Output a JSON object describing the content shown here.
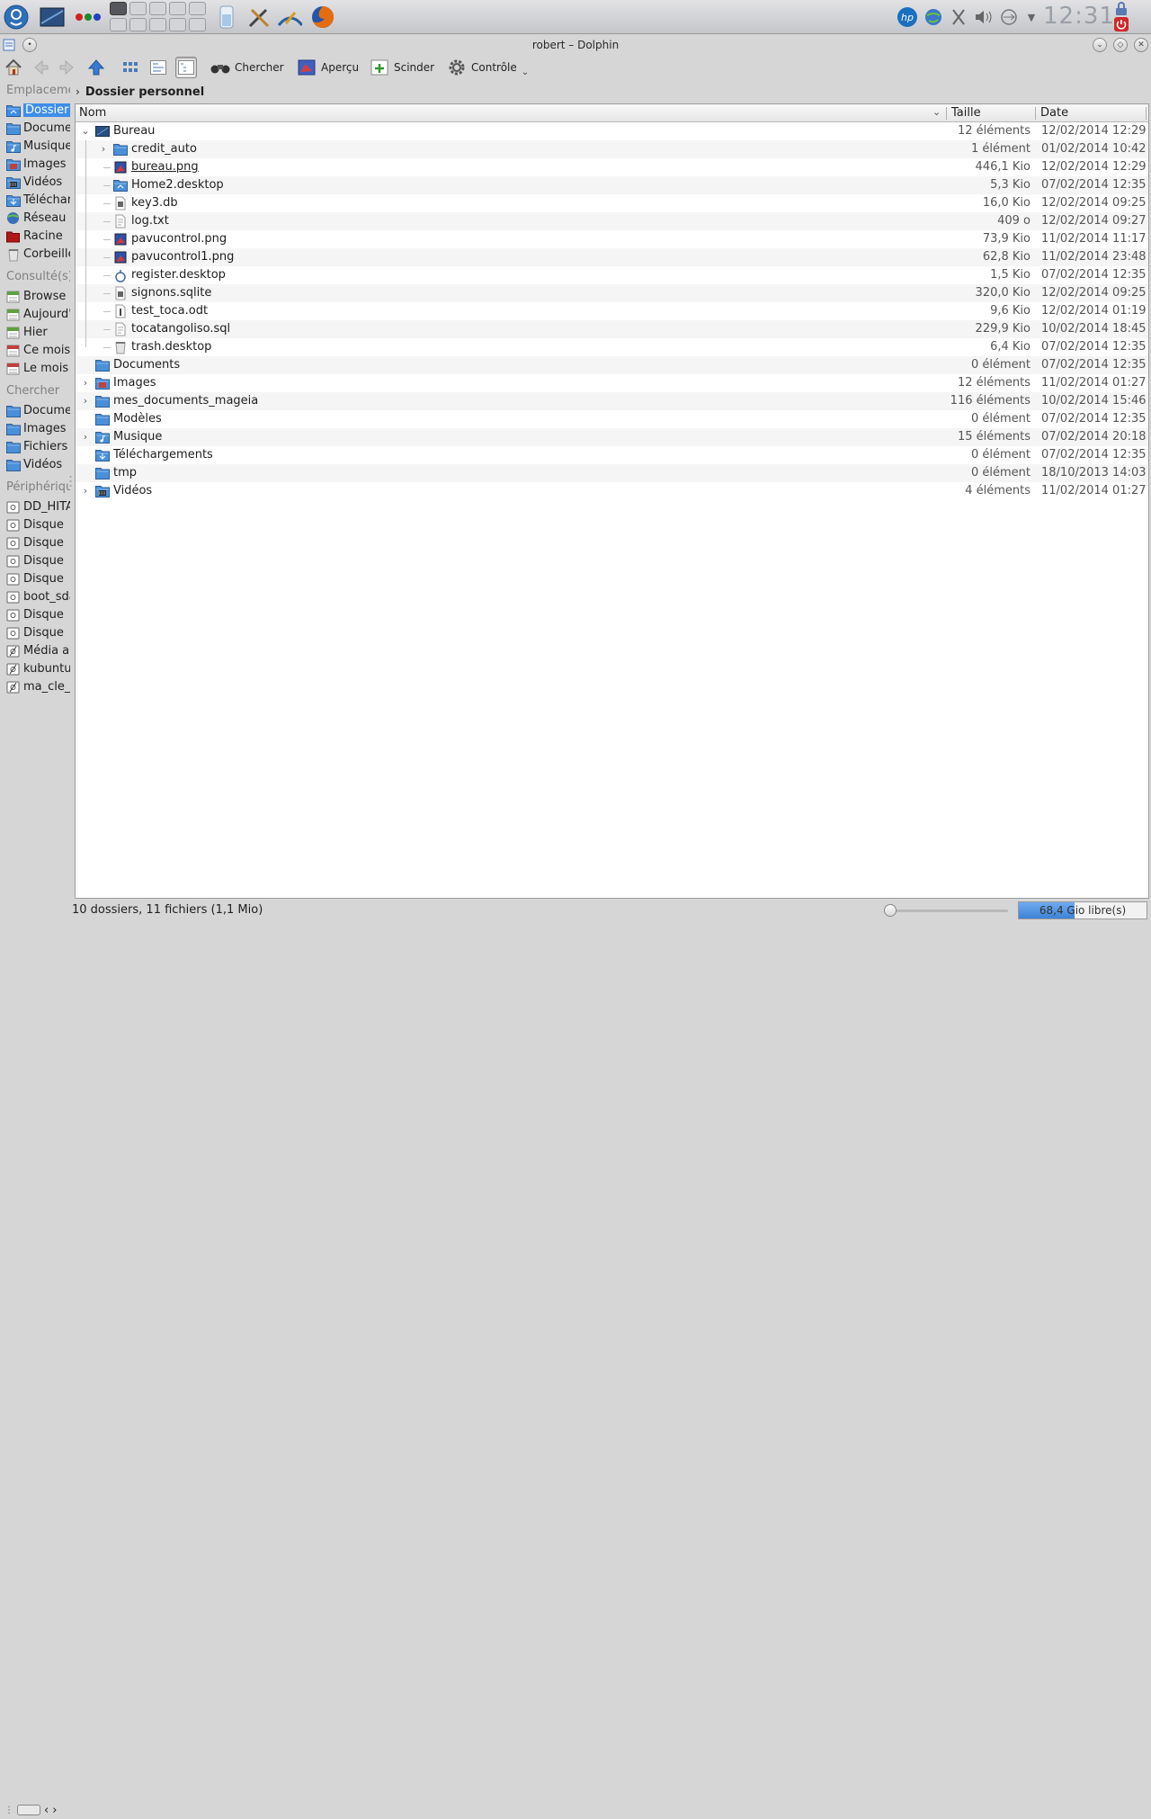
{
  "panel": {
    "clock": "12:31",
    "icons": [
      "mageia-menu-icon",
      "desktop-icon",
      "colors-icon",
      "battery-widget-icon",
      "tools-icon",
      "draw-icon",
      "firefox-icon"
    ],
    "tray": [
      "hp-icon",
      "network-globe-icon",
      "scissors-icon",
      "volume-icon",
      "usb-icon",
      "chevron-down-icon",
      "lock-icon",
      "power-icon"
    ]
  },
  "window": {
    "title": "robert – Dolphin"
  },
  "toolbar": {
    "search": "Chercher",
    "preview": "Aperçu",
    "split": "Scinder",
    "control": "Contrôle"
  },
  "places": {
    "sections": [
      {
        "title": "Emplacements",
        "items": [
          {
            "label": "Dossier personnel",
            "icon": "home-folder-icon",
            "color": "#3d8ee6"
          },
          {
            "label": "Documents",
            "icon": "folder-icon",
            "color": "#4a90d9"
          },
          {
            "label": "Musique",
            "icon": "music-folder-icon",
            "color": "#4a90d9"
          },
          {
            "label": "Images",
            "icon": "images-folder-icon",
            "color": "#4a90d9"
          },
          {
            "label": "Vidéos",
            "icon": "videos-folder-icon",
            "color": "#4a90d9"
          },
          {
            "label": "Téléchargements",
            "icon": "download-folder-icon",
            "color": "#4a90d9"
          },
          {
            "label": "Réseau",
            "icon": "network-icon",
            "color": "#3a6fb8"
          },
          {
            "label": "Racine",
            "icon": "root-folder-icon",
            "color": "#b01818"
          },
          {
            "label": "Corbeille",
            "icon": "trash-icon",
            "color": "#bdbdbd"
          }
        ]
      },
      {
        "title": "Consulté(s) récemment",
        "items": [
          {
            "label": "Browse",
            "icon": "calendar-icon",
            "color": "#60a040"
          },
          {
            "label": "Aujourd'hui",
            "icon": "calendar-icon",
            "color": "#60a040"
          },
          {
            "label": "Hier",
            "icon": "calendar-icon",
            "color": "#60a040"
          },
          {
            "label": "Ce mois",
            "icon": "calendar-icon",
            "color": "#c04040"
          },
          {
            "label": "Le mois dernier",
            "icon": "calendar-icon",
            "color": "#c04040"
          }
        ]
      },
      {
        "title": "Chercher",
        "items": [
          {
            "label": "Documents",
            "icon": "search-documents-icon",
            "color": "#4a90d9"
          },
          {
            "label": "Images",
            "icon": "search-images-icon",
            "color": "#4a90d9"
          },
          {
            "label": "Fichiers audio",
            "icon": "search-audio-icon",
            "color": "#4a90d9"
          },
          {
            "label": "Vidéos",
            "icon": "search-videos-icon",
            "color": "#4a90d9"
          }
        ]
      },
      {
        "title": "Périphériques",
        "items": [
          {
            "label": "DD_HITACHI",
            "icon": "drive-icon",
            "color": "#888"
          },
          {
            "label": "Disque",
            "icon": "drive-icon",
            "color": "#888"
          },
          {
            "label": "Disque",
            "icon": "drive-icon",
            "color": "#888"
          },
          {
            "label": "Disque",
            "icon": "drive-icon",
            "color": "#888"
          },
          {
            "label": "Disque",
            "icon": "drive-icon",
            "color": "#888"
          },
          {
            "label": "boot_sda",
            "icon": "drive-icon",
            "color": "#888"
          },
          {
            "label": "Disque",
            "icon": "drive-icon",
            "color": "#888"
          },
          {
            "label": "Disque",
            "icon": "drive-icon",
            "color": "#888"
          },
          {
            "label": "Média amovible",
            "icon": "removable-drive-icon",
            "color": "#888"
          },
          {
            "label": "kubuntu",
            "icon": "removable-drive-icon",
            "color": "#888"
          },
          {
            "label": "ma_cle_usb",
            "icon": "removable-drive-icon",
            "color": "#888"
          }
        ]
      }
    ]
  },
  "breadcrumb": {
    "current": "Dossier personnel"
  },
  "columns": {
    "name": "Nom",
    "size": "Taille",
    "date": "Date"
  },
  "files": [
    {
      "name": "Bureau",
      "size": "12 éléments",
      "date": "12/02/2014 12:29",
      "level": 0,
      "exp": "open",
      "icon": "desktop-folder-icon"
    },
    {
      "name": "credit_auto",
      "size": "1 élément",
      "date": "01/02/2014 10:42",
      "level": 1,
      "exp": "closed",
      "icon": "folder-icon"
    },
    {
      "name": "bureau.png",
      "size": "446,1 Kio",
      "date": "12/02/2014 12:29",
      "level": 1,
      "exp": "",
      "icon": "image-file-icon",
      "hover": true
    },
    {
      "name": "Home2.desktop",
      "size": "5,3 Kio",
      "date": "07/02/2014 12:35",
      "level": 1,
      "exp": "",
      "icon": "home-folder-icon"
    },
    {
      "name": "key3.db",
      "size": "16,0 Kio",
      "date": "12/02/2014 09:25",
      "level": 1,
      "exp": "",
      "icon": "db-file-icon"
    },
    {
      "name": "log.txt",
      "size": "409 o",
      "date": "12/02/2014 09:27",
      "level": 1,
      "exp": "",
      "icon": "text-file-icon"
    },
    {
      "name": "pavucontrol.png",
      "size": "73,9 Kio",
      "date": "11/02/2014 11:17",
      "level": 1,
      "exp": "",
      "icon": "image-file-icon"
    },
    {
      "name": "pavucontrol1.png",
      "size": "62,8 Kio",
      "date": "11/02/2014 23:48",
      "level": 1,
      "exp": "",
      "icon": "image-file-icon"
    },
    {
      "name": "register.desktop",
      "size": "1,5 Kio",
      "date": "07/02/2014 12:35",
      "level": 1,
      "exp": "",
      "icon": "register-icon"
    },
    {
      "name": "signons.sqlite",
      "size": "320,0 Kio",
      "date": "12/02/2014 09:25",
      "level": 1,
      "exp": "",
      "icon": "db-file-icon"
    },
    {
      "name": "test_toca.odt",
      "size": "9,6 Kio",
      "date": "12/02/2014 01:19",
      "level": 1,
      "exp": "",
      "icon": "odt-file-icon"
    },
    {
      "name": "tocatangoliso.sql",
      "size": "229,9 Kio",
      "date": "10/02/2014 18:45",
      "level": 1,
      "exp": "",
      "icon": "text-file-icon"
    },
    {
      "name": "trash.desktop",
      "size": "6,4 Kio",
      "date": "07/02/2014 12:35",
      "level": 1,
      "exp": "",
      "icon": "trash-icon"
    },
    {
      "name": "Documents",
      "size": "0 élément",
      "date": "07/02/2014 12:35",
      "level": 0,
      "exp": "",
      "icon": "folder-icon"
    },
    {
      "name": "Images",
      "size": "12 éléments",
      "date": "11/02/2014 01:27",
      "level": 0,
      "exp": "closed",
      "icon": "images-folder-icon"
    },
    {
      "name": "mes_documents_mageia",
      "size": "116 éléments",
      "date": "10/02/2014 15:46",
      "level": 0,
      "exp": "closed",
      "icon": "folder-icon"
    },
    {
      "name": "Modèles",
      "size": "0 élément",
      "date": "07/02/2014 12:35",
      "level": 0,
      "exp": "",
      "icon": "folder-icon"
    },
    {
      "name": "Musique",
      "size": "15 éléments",
      "date": "07/02/2014 20:18",
      "level": 0,
      "exp": "closed",
      "icon": "music-folder-icon"
    },
    {
      "name": "Téléchargements",
      "size": "0 élément",
      "date": "07/02/2014 12:35",
      "level": 0,
      "exp": "",
      "icon": "download-folder-icon"
    },
    {
      "name": "tmp",
      "size": "0 élément",
      "date": "18/10/2013 14:03",
      "level": 0,
      "exp": "",
      "icon": "folder-icon"
    },
    {
      "name": "Vidéos",
      "size": "4 éléments",
      "date": "11/02/2014 01:27",
      "level": 0,
      "exp": "closed",
      "icon": "videos-folder-icon"
    }
  ],
  "status": {
    "summary": "10 dossiers, 11 fichiers (1,1 Mio)",
    "free_space": "68,4 Gio libre(s)",
    "used_fraction": 0.44,
    "zoom_fraction": 0.03
  }
}
